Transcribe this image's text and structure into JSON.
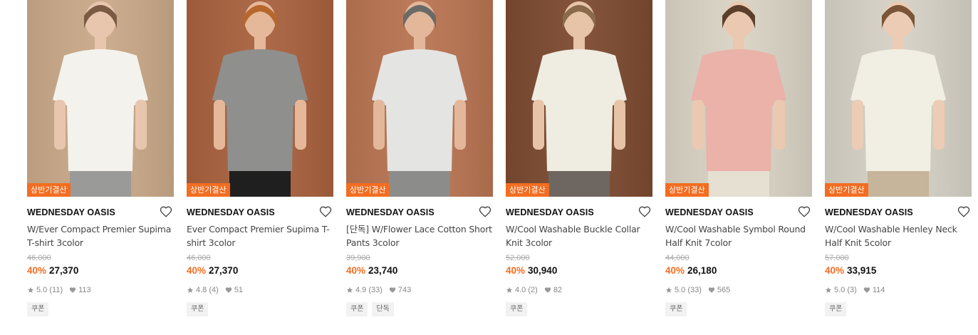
{
  "products": [
    {
      "badge": "상반기결산",
      "brand": "WEDNESDAY OASIS",
      "name": "W/Ever Compact Premier Supima T-shirt 3color",
      "original_price": "46,000",
      "discount": "40%",
      "price": "27,370",
      "rating": "5.0",
      "reviews": "(11)",
      "likes": "113",
      "tags": [
        "쿠폰"
      ],
      "colors": {
        "bg": "#c9a888",
        "top": "#f4f2ec",
        "bottom": "#9a9a98",
        "skin": "#e8c6ad",
        "hair": "#7a5a42"
      }
    },
    {
      "badge": "상반기결산",
      "brand": "WEDNESDAY OASIS",
      "name": "Ever Compact Premier Supima T-shirt 3color",
      "original_price": "46,000",
      "discount": "40%",
      "price": "27,370",
      "rating": "4.8",
      "reviews": "(4)",
      "likes": "51",
      "tags": [
        "쿠폰"
      ],
      "colors": {
        "bg": "#a8613e",
        "top": "#8f8f8d",
        "bottom": "#1f1f1f",
        "skin": "#e5b89a",
        "hair": "#b8672c"
      }
    },
    {
      "badge": "상반기결산",
      "brand": "WEDNESDAY OASIS",
      "name": "[단독] W/Flower Lace Cotton Short Pants 3color",
      "original_price": "39,900",
      "discount": "40%",
      "price": "23,740",
      "rating": "4.9",
      "reviews": "(33)",
      "likes": "743",
      "tags": [
        "쿠폰",
        "단독"
      ],
      "colors": {
        "bg": "#b87452",
        "top": "#e4e4e2",
        "bottom": "#8c8c8a",
        "skin": "#e3b79a",
        "hair": "#6a6a68"
      }
    },
    {
      "badge": "상반기결산",
      "brand": "WEDNESDAY OASIS",
      "name": "W/Cool Washable Buckle Collar Knit 3color",
      "original_price": "52,000",
      "discount": "40%",
      "price": "30,940",
      "rating": "4.0",
      "reviews": "(2)",
      "likes": "82",
      "tags": [
        "쿠폰"
      ],
      "colors": {
        "bg": "#7c4a30",
        "top": "#efece2",
        "bottom": "#6e6761",
        "skin": "#e7c3a8",
        "hair": "#8a6a4a"
      }
    },
    {
      "badge": "상반기결산",
      "brand": "WEDNESDAY OASIS",
      "name": "W/Cool Washable Symbol Round Half Knit 7color",
      "original_price": "44,000",
      "discount": "40%",
      "price": "26,180",
      "rating": "5.0",
      "reviews": "(33)",
      "likes": "565",
      "tags": [
        "쿠폰"
      ],
      "colors": {
        "bg": "#d9d3c4",
        "top": "#eab2a9",
        "bottom": "#e6e0d2",
        "skin": "#ebc9b1",
        "hair": "#5b3f2c"
      }
    },
    {
      "badge": "상반기결산",
      "brand": "WEDNESDAY OASIS",
      "name": "W/Cool Washable Henley Neck Half Knit 5color",
      "original_price": "57,000",
      "discount": "40%",
      "price": "33,915",
      "rating": "5.0",
      "reviews": "(3)",
      "likes": "114",
      "tags": [
        "쿠폰"
      ],
      "colors": {
        "bg": "#d5d1c6",
        "top": "#f1efe4",
        "bottom": "#c6b59a",
        "skin": "#ecccb4",
        "hair": "#7a5538"
      }
    }
  ]
}
